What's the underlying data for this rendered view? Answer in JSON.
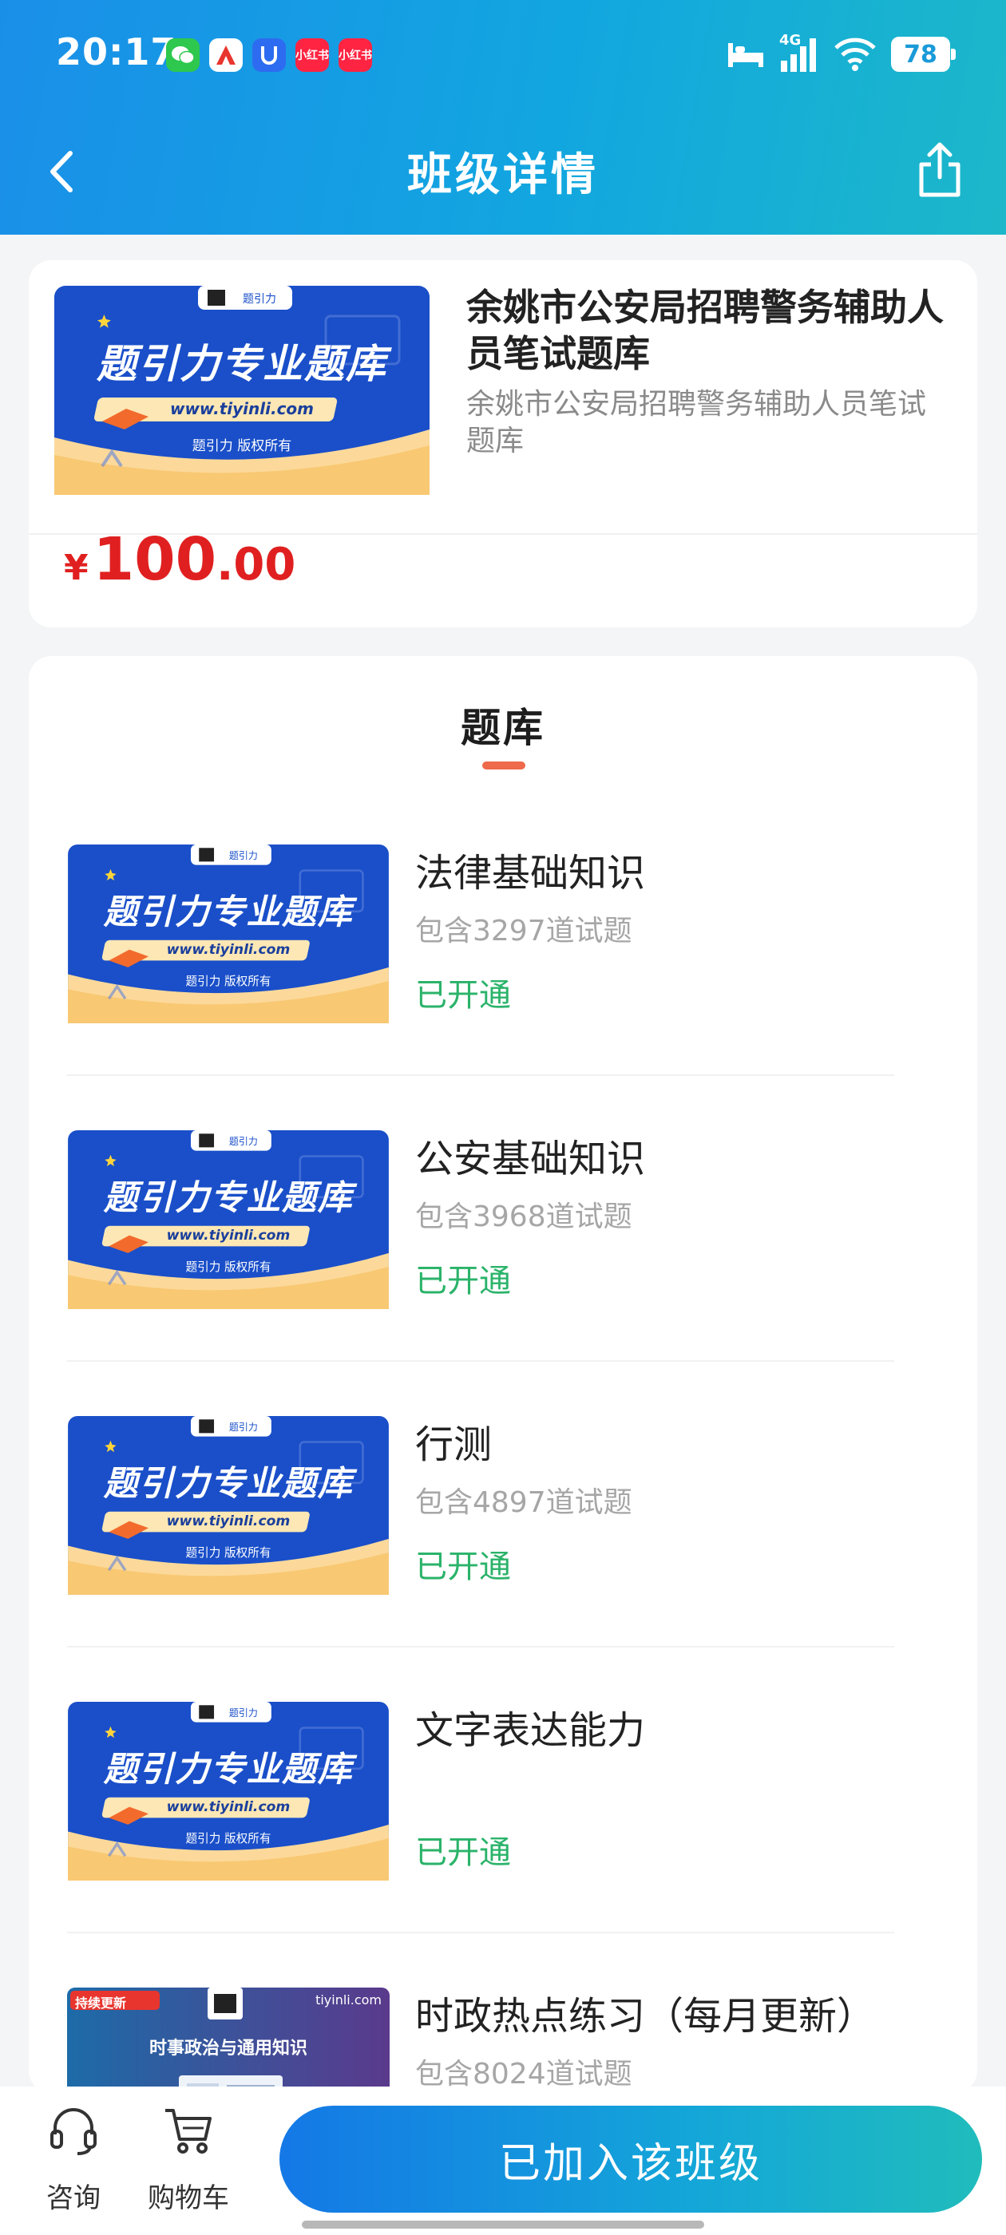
{
  "status_bar": {
    "time": "20:17",
    "battery": "78",
    "network": "4G",
    "app_icons": [
      {
        "name": "wechat-icon",
        "color": "#2dc84d",
        "label": ""
      },
      {
        "name": "exam-app-icon",
        "color": "#e8352e",
        "label": "A"
      },
      {
        "name": "shield-app-icon",
        "color": "#2d6cf0",
        "label": "U"
      },
      {
        "name": "xiaohongshu-icon",
        "color": "#ff2442",
        "label": "小红书"
      },
      {
        "name": "xiaohongshu-icon-2",
        "color": "#ff2442",
        "label": "小红书"
      }
    ]
  },
  "nav": {
    "title": "班级详情",
    "back_icon": "chevron-left-icon",
    "share_icon": "share-icon"
  },
  "cover": {
    "brand": "题引力",
    "headline": "题引力专业题库",
    "url": "www.tiyinli.com",
    "copyright": "题引力 版权所有"
  },
  "course": {
    "title": "余姚市公安局招聘警务辅助人员笔试题库",
    "subtitle": "余姚市公安局招聘警务辅助人员笔试题库",
    "price_currency": "¥",
    "price_integer": "100",
    "price_decimal": ".00"
  },
  "bank_section": {
    "title": "题库",
    "items": [
      {
        "name": "法律基础知识",
        "count": "包含3297道试题",
        "status": "已开通",
        "cover": "standard"
      },
      {
        "name": "公安基础知识",
        "count": "包含3968道试题",
        "status": "已开通",
        "cover": "standard"
      },
      {
        "name": "行测",
        "count": "包含4897道试题",
        "status": "已开通",
        "cover": "standard"
      },
      {
        "name": "文字表达能力",
        "count": "",
        "status": "已开通",
        "cover": "standard"
      },
      {
        "name": "时政热点练习（每月更新）",
        "count": "包含8024道试题",
        "status": "",
        "cover": "current-affairs"
      }
    ],
    "current_affairs_cover": {
      "badge": "持续更新",
      "site": "tiyinli.com",
      "headline": "时事政治与通用知识"
    }
  },
  "bottom_bar": {
    "consult_label": "咨询",
    "cart_label": "购物车",
    "joined_button": "已加入该班级"
  },
  "colors": {
    "header_gradient_start": "#1a8fe8",
    "header_gradient_end": "#1cb8c9",
    "price_red": "#e02020",
    "status_green": "#2bb36a",
    "underline_orange": "#ee6a4a"
  }
}
